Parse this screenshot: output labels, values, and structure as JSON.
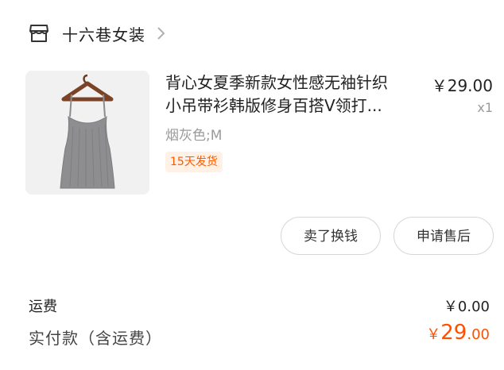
{
  "shop": {
    "name": "十六巷女装",
    "icon": "store-icon",
    "chevron_icon": "chevron-right-icon"
  },
  "product": {
    "title_line1": "背心女夏季新款女性感无袖针织",
    "title_line2": "小吊带衫韩版修身百搭V领打...",
    "price": "￥29.00",
    "quantity": "x1",
    "spec": "烟灰色;M",
    "ship_tag": "15天发货",
    "image": "gray-knit-camisole-on-hanger"
  },
  "actions": {
    "sell_label": "卖了换钱",
    "after_sale_label": "申请售后"
  },
  "fees": {
    "shipping_label": "运费",
    "shipping_value": "￥0.00",
    "paid_label": "实付款（含运费）",
    "paid_currency": "￥",
    "paid_integer": "29",
    "paid_decimal": ".00"
  },
  "colors": {
    "accent": "#ff5000",
    "tag_bg": "#fff1e6",
    "muted_text": "#9a9a9a"
  }
}
